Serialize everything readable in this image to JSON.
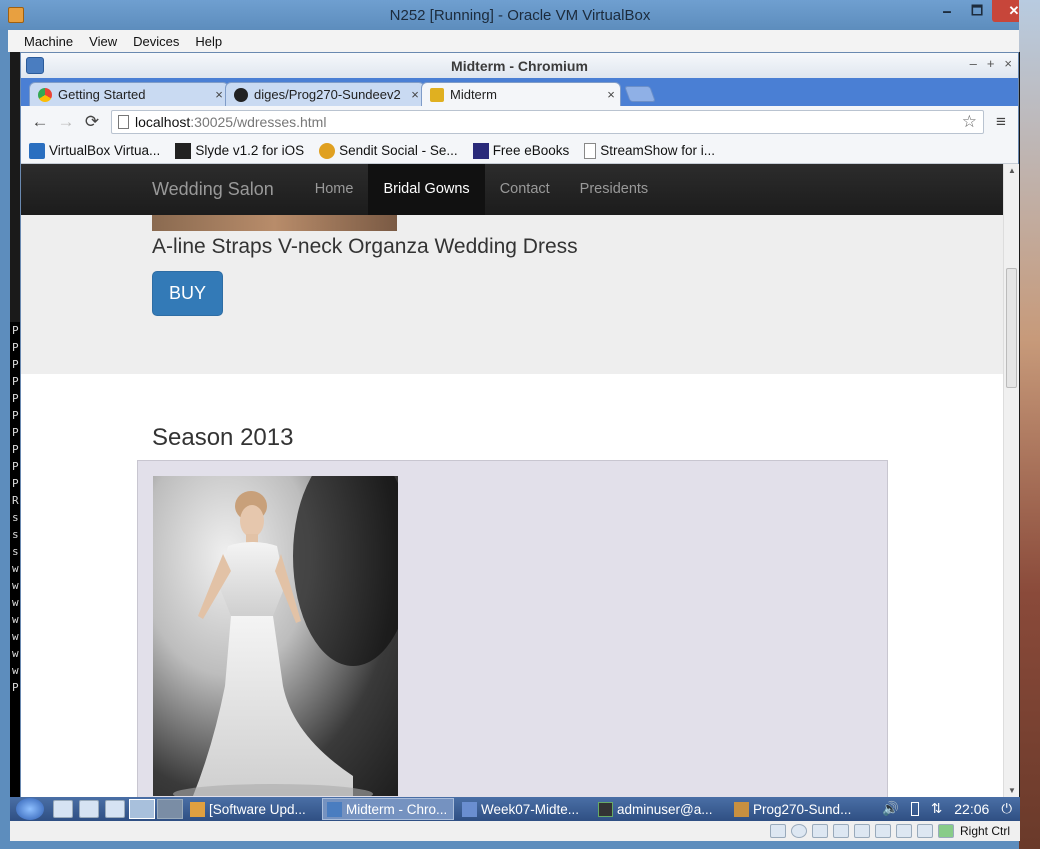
{
  "vbox": {
    "title": "N252 [Running] - Oracle VM VirtualBox",
    "minimize": "🗕",
    "maximize": "🗖",
    "close": "✕",
    "menu": [
      "Machine",
      "View",
      "Devices",
      "Help"
    ],
    "host_key": "Right Ctrl"
  },
  "guest_terminal_letters": "P\nP\nP\nP\nP\nP\nP\nP\nP\nP\nR\ns\ns\ns\nw\nw\nw\nw\nw\nw\nw\nP",
  "chrome": {
    "title": "Midterm - Chromium",
    "ctrl_min": "–",
    "ctrl_max": "+",
    "ctrl_close": "×",
    "tabs": [
      {
        "label": "Getting Started",
        "close": "×",
        "favicon_color": "#4285f4"
      },
      {
        "label": "diges/Prog270-Sundeev2",
        "close": "×",
        "favicon_color": "#222222"
      },
      {
        "label": "Midterm",
        "close": "×",
        "favicon_color": "#e0b020"
      }
    ],
    "back": "←",
    "forward": "→",
    "reload": "⟳",
    "url_host": "localhost",
    "url_path": ":30025/wdresses.html",
    "star": "☆",
    "menu_icon": "≡",
    "bookmarks": [
      {
        "label": "VirtualBox Virtua...",
        "color": "#2a6fc0"
      },
      {
        "label": "Slyde v1.2 for iOS",
        "color": "#222222"
      },
      {
        "label": "Sendit Social - Se...",
        "color": "#e0a020"
      },
      {
        "label": "Free eBooks",
        "color": "#2a2a7a"
      },
      {
        "label": "StreamShow for i...",
        "color": "#ffffff"
      }
    ]
  },
  "site": {
    "brand": "Wedding Salon",
    "nav": [
      "Home",
      "Bridal Gowns",
      "Contact",
      "Presidents"
    ],
    "active_nav": 1,
    "dress_title": "A-line Straps V-neck Organza Wedding Dress",
    "buy_label": "BUY",
    "season_heading": "Season 2013"
  },
  "taskbar": {
    "tasks": [
      {
        "label": "[Software Upd...",
        "color": "#e0a040"
      },
      {
        "label": "Midterm - Chro...",
        "color": "#4a7dc0"
      },
      {
        "label": "Week07-Midte...",
        "color": "#6a8ed0"
      },
      {
        "label": "adminuser@a...",
        "color": "#333333"
      },
      {
        "label": "Prog270-Sund...",
        "color": "#c89040"
      }
    ],
    "active_task": 1,
    "volume_icon": "🔊",
    "network_icon": "⇅",
    "power_icon": "⏻",
    "clock": "22:06"
  },
  "colors": {
    "navbar": "#222222",
    "buy_button": "#337ab7",
    "jumbotron": "#eeeeee",
    "gallery_box": "#e2e0ea"
  }
}
